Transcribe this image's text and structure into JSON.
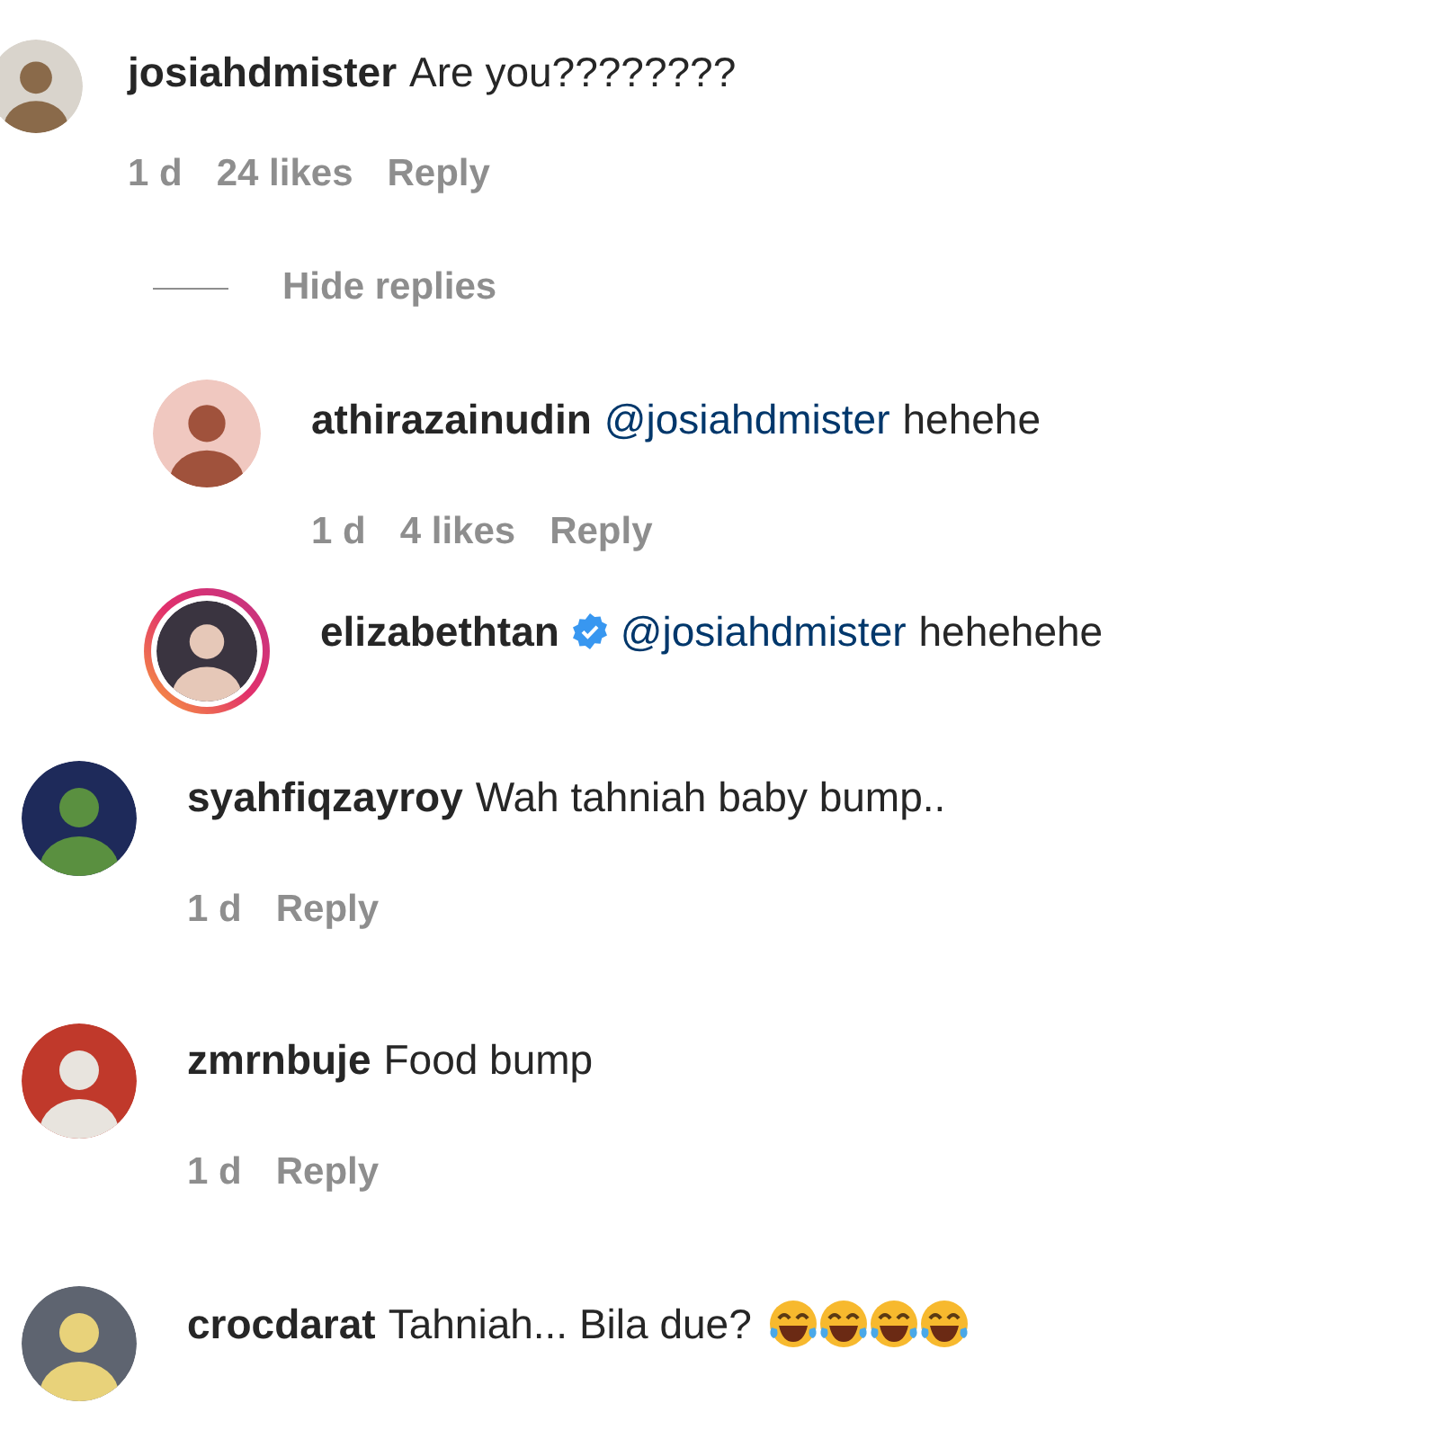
{
  "thread": {
    "comment": {
      "username": "josiahdmister",
      "parts": [
        {
          "kind": "plain",
          "text": "Are you????????"
        }
      ],
      "meta": {
        "time": "1 d",
        "likes": "24 likes",
        "reply": "Reply"
      }
    },
    "toggle": {
      "label": "Hide replies"
    },
    "replies": [
      {
        "username": "athirazainudin",
        "parts": [
          {
            "kind": "mention",
            "text": "@josiahdmister"
          },
          {
            "kind": "plain",
            "text": "hehehe"
          }
        ],
        "meta": {
          "time": "1 d",
          "likes": "4 likes",
          "reply": "Reply"
        }
      },
      {
        "username": "elizabethtan",
        "verified": true,
        "story_ring": true,
        "parts": [
          {
            "kind": "mention",
            "text": "@josiahdmister"
          },
          {
            "kind": "plain",
            "text": "hehehehe"
          }
        ]
      }
    ]
  },
  "comments": [
    {
      "username": "syahfiqzayroy",
      "parts": [
        {
          "kind": "plain",
          "text": "Wah tahniah baby bump.."
        }
      ],
      "meta": {
        "time": "1 d",
        "reply": "Reply"
      }
    },
    {
      "username": "zmrnbuje",
      "parts": [
        {
          "kind": "plain",
          "text": "Food bump"
        }
      ],
      "meta": {
        "time": "1 d",
        "reply": "Reply"
      }
    },
    {
      "username": "crocdarat",
      "parts": [
        {
          "kind": "plain",
          "text": "Tahniah... Bila due?"
        },
        {
          "kind": "emoji"
        },
        {
          "kind": "emoji"
        },
        {
          "kind": "emoji"
        },
        {
          "kind": "emoji"
        }
      ]
    }
  ]
}
